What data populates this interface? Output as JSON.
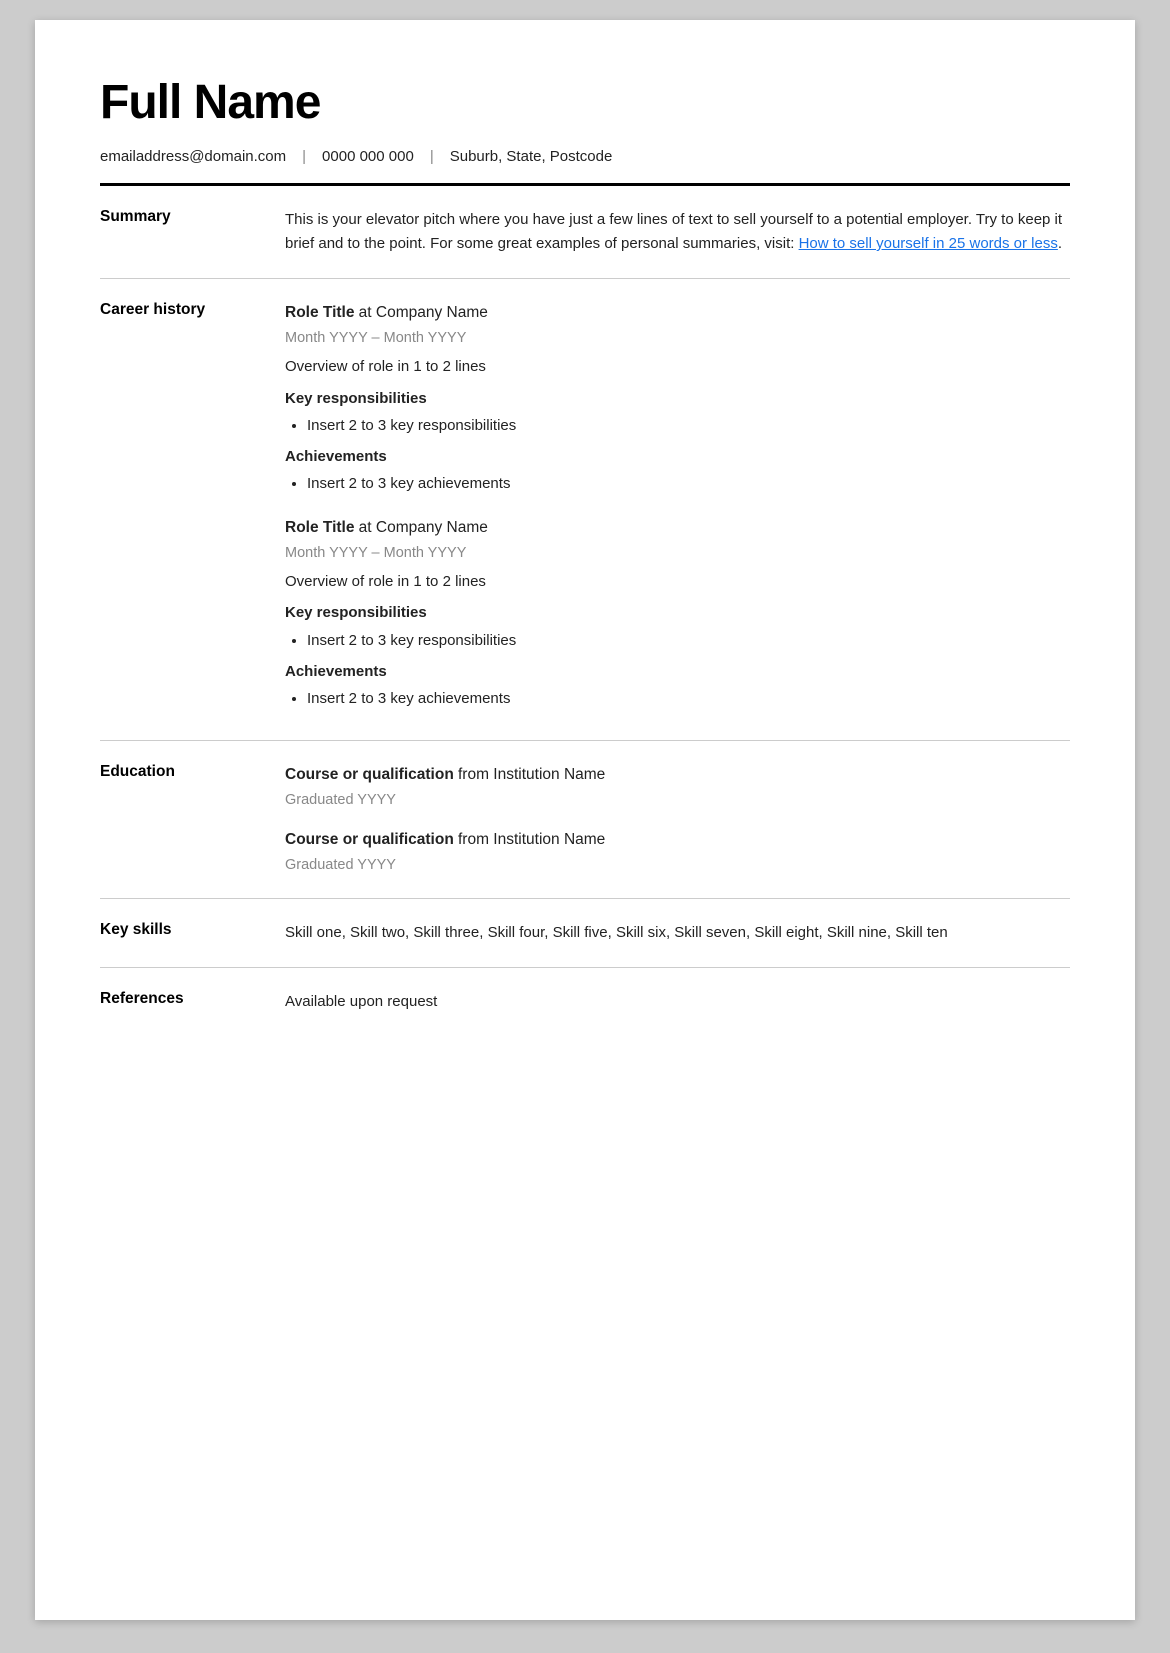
{
  "header": {
    "name": "Full Name",
    "email": "emailaddress@domain.com",
    "phone": "0000 000 000",
    "location": "Suburb, State, Postcode"
  },
  "sections": {
    "summary": {
      "label": "Summary",
      "text_part1": "This is your elevator pitch where you have just a few lines of text to sell yourself to a potential employer. Try to keep it brief and to the point. For some great examples of personal summaries, visit: ",
      "link_text": "How to sell yourself in 25 words or less",
      "text_part2": "."
    },
    "career_history": {
      "label": "Career history",
      "roles": [
        {
          "title": "Role Title",
          "company": "at Company Name",
          "dates": "Month YYYY – Month YYYY",
          "overview": "Overview of role in 1 to 2 lines",
          "responsibilities_label": "Key responsibilities",
          "responsibilities": [
            "Insert 2 to 3 key responsibilities"
          ],
          "achievements_label": "Achievements",
          "achievements": [
            "Insert 2 to 3 key achievements"
          ]
        },
        {
          "title": "Role Title",
          "company": "at Company Name",
          "dates": "Month YYYY – Month YYYY",
          "overview": "Overview of role in 1 to 2 lines",
          "responsibilities_label": "Key responsibilities",
          "responsibilities": [
            "Insert 2 to 3 key responsibilities"
          ],
          "achievements_label": "Achievements",
          "achievements": [
            "Insert 2 to 3 key achievements"
          ]
        }
      ]
    },
    "education": {
      "label": "Education",
      "entries": [
        {
          "course": "Course or qualification",
          "institution": "from Institution Name",
          "graduated": "Graduated YYYY"
        },
        {
          "course": "Course or qualification",
          "institution": "from Institution Name",
          "graduated": "Graduated YYYY"
        }
      ]
    },
    "key_skills": {
      "label": "Key skills",
      "skills": "Skill one, Skill two, Skill three, Skill four, Skill five, Skill six, Skill seven, Skill eight, Skill nine, Skill ten"
    },
    "references": {
      "label": "References",
      "text": "Available upon request"
    }
  }
}
